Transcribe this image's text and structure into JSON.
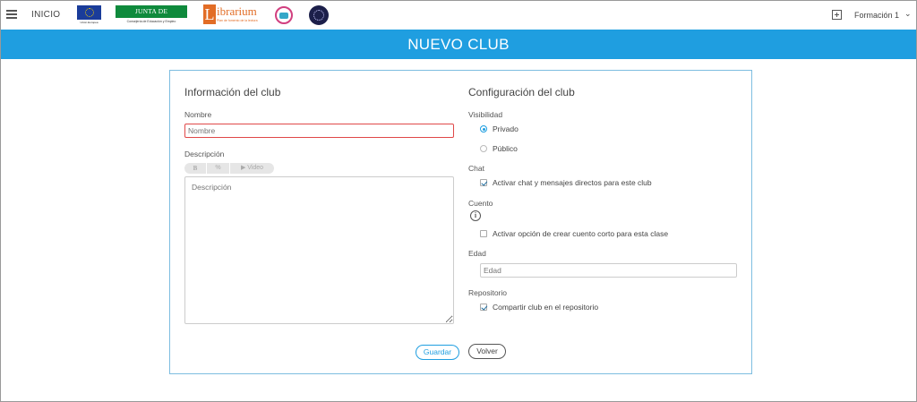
{
  "header": {
    "home_label": "INICIO",
    "logos": {
      "eu_caption": "Unión Europea",
      "junta_name": "JUNTA DE EXTREMADURA",
      "junta_caption": "Consejería de Educación y Empleo",
      "librarium_initial": "L",
      "librarium_rest": "ibrarium",
      "librarium_tagline": "Plan de fomento de la lectura"
    },
    "user_name": "Formación 1"
  },
  "banner": {
    "title": "NUEVO CLUB"
  },
  "club_info": {
    "section_title": "Información del club",
    "name_label": "Nombre",
    "name_placeholder": "Nombre",
    "description_label": "Descripción",
    "toolbar": {
      "bold": "B",
      "link": "%",
      "video": "Video"
    },
    "description_placeholder": "Descripción"
  },
  "club_config": {
    "section_title": "Configuración del club",
    "visibility_label": "Visibilidad",
    "visibility_options": [
      {
        "label": "Privado",
        "selected": true
      },
      {
        "label": "Público",
        "selected": false
      }
    ],
    "chat_label": "Chat",
    "chat_option": {
      "label": "Activar chat y mensajes directos para este club",
      "checked": true
    },
    "story_label": "Cuento",
    "story_option": {
      "label": "Activar opción de crear cuento corto para esta clase",
      "checked": false
    },
    "age_label": "Edad",
    "age_placeholder": "Edad",
    "repository_label": "Repositorio",
    "repository_option": {
      "label": "Compartir club en el repositorio",
      "checked": true
    }
  },
  "actions": {
    "save_label": "Guardar",
    "back_label": "Volver"
  },
  "colors": {
    "primary": "#1f9ee0",
    "error": "#e04848"
  },
  "icons": [
    "menu-icon",
    "add-icon",
    "chevron-down-icon",
    "info-icon",
    "bold-icon",
    "link-icon",
    "video-icon"
  ]
}
